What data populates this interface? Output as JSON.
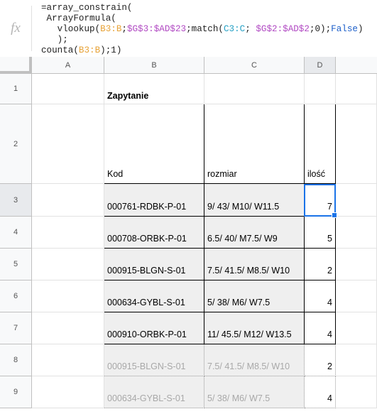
{
  "formula_bar": {
    "icon": "fx-icon",
    "lines": [
      "=array_constrain(",
      " ArrayFormula(",
      "   vlookup(B3:B;$G$3:$AD$23;match(C3:C; $G$2:$AD$2;0);False)",
      "   );",
      "counta(B3:B);1)"
    ]
  },
  "columns": [
    "A",
    "B",
    "C",
    "D"
  ],
  "rows": [
    "1",
    "2",
    "3",
    "4",
    "5",
    "6",
    "7",
    "8",
    "9"
  ],
  "sheet": {
    "title": "Zapytanie",
    "headers": {
      "code": "Kod",
      "size": "rozmiar",
      "qty": "ilość"
    },
    "data_rows": [
      {
        "code": "000761-RDBK-P-01",
        "size": "9/ 43/ M10/ W11.5",
        "qty": "7"
      },
      {
        "code": "000708-ORBK-P-01",
        "size": "6.5/ 40/ M7.5/ W9",
        "qty": "5"
      },
      {
        "code": "000915-BLGN-S-01",
        "size": "7.5/ 41.5/ M8.5/ W10",
        "qty": "2"
      },
      {
        "code": "000634-GYBL-S-01",
        "size": "5/ 38/ M6/ W7.5",
        "qty": "4"
      },
      {
        "code": "000910-ORBK-P-01",
        "size": "11/ 45.5/ M12/ W13.5",
        "qty": "4"
      },
      {
        "code": "000915-BLGN-S-01",
        "size": "7.5/ 41.5/ M8.5/ W10",
        "qty": "2"
      },
      {
        "code": "000634-GYBL-S-01",
        "size": "5/ 38/ M6/ W7.5",
        "qty": "4"
      }
    ]
  },
  "colors": {
    "selection": "#1a73e8",
    "range_b": "#e7a339",
    "range_g": "#b14ac3",
    "range_c": "#27a1c5"
  }
}
